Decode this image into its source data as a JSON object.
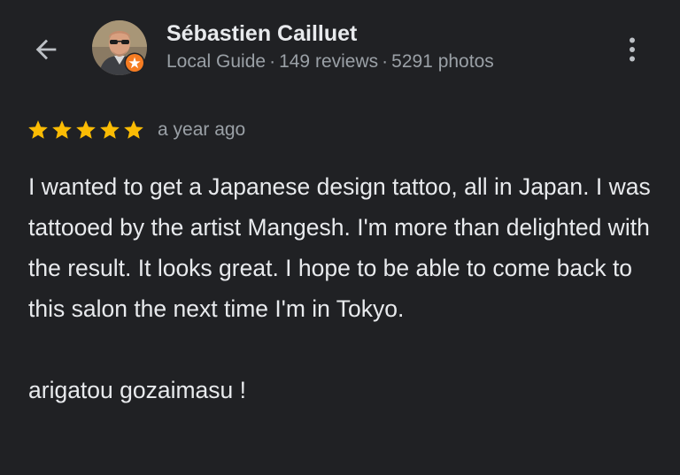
{
  "header": {
    "reviewer_name": "Sébastien Cailluet",
    "guide_label": "Local Guide",
    "reviews_count": "149 reviews",
    "photos_count": "5291 photos",
    "separator": "·"
  },
  "review": {
    "rating": 5,
    "rating_max": 5,
    "time_ago": "a year ago",
    "body": "I wanted to get a Japanese design tattoo, all in Japan. I was tattooed by the artist Mangesh. I'm more than delighted with the result. It looks great. I hope to be able to come back to this salon the next time I'm in Tokyo.",
    "signoff": "arigatou gozaimasu !"
  },
  "icons": {
    "back": "arrow-back-icon",
    "more": "more-vert-icon",
    "star": "star-icon",
    "badge": "local-guide-badge-icon"
  },
  "colors": {
    "background": "#202124",
    "primary_text": "#e8eaed",
    "secondary_text": "#9aa0a6",
    "star": "#fbbc04",
    "badge": "#f57c22"
  }
}
